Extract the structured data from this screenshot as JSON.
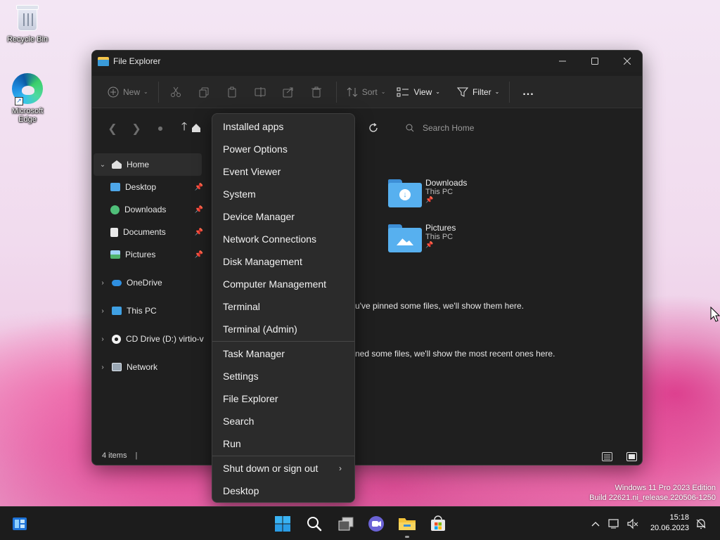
{
  "desktop": {
    "icons": [
      {
        "label": "Recycle Bin"
      },
      {
        "label": "Microsoft Edge"
      }
    ],
    "watermark": {
      "line1": "Windows 11 Pro 2023 Edition",
      "line2": "Build 22621.ni_release.220506-1250"
    }
  },
  "explorer": {
    "title": "File Explorer",
    "commands": {
      "new": "New",
      "sort": "Sort",
      "view": "View",
      "filter": "Filter",
      "more": "..."
    },
    "search_placeholder": "Search Home",
    "nav": [
      {
        "label": "Home"
      },
      {
        "label": "Desktop"
      },
      {
        "label": "Downloads"
      },
      {
        "label": "Documents"
      },
      {
        "label": "Pictures"
      },
      {
        "label": "OneDrive"
      },
      {
        "label": "This PC"
      },
      {
        "label": "CD Drive (D:) virtio-v"
      },
      {
        "label": "Network"
      }
    ],
    "quick_access": [
      {
        "name": "Downloads",
        "location": "This PC"
      },
      {
        "name": "Pictures",
        "location": "This PC"
      }
    ],
    "favorites_empty": "u've pinned some files, we'll show them here.",
    "recent_empty": "ned some files, we'll show the most recent ones here.",
    "status": "4 items"
  },
  "context_menu": {
    "items": [
      "Installed apps",
      "Power Options",
      "Event Viewer",
      "System",
      "Device Manager",
      "Network Connections",
      "Disk Management",
      "Computer Management",
      "Terminal",
      "Terminal (Admin)",
      "Task Manager",
      "Settings",
      "File Explorer",
      "Search",
      "Run",
      "Shut down or sign out",
      "Desktop"
    ]
  },
  "taskbar": {
    "time": "15:18",
    "date": "20.06.2023"
  },
  "colors": {
    "accent": "#4cc2ff",
    "window_bg": "#1f1f1f",
    "menu_bg": "#2b2b2b",
    "taskbar_bg": "#1c1c1c"
  }
}
